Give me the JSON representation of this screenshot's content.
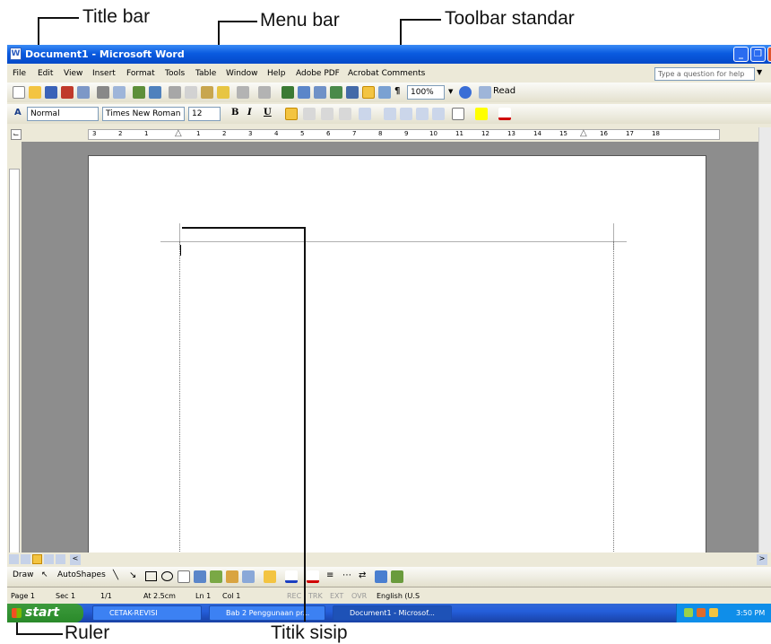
{
  "annotations": {
    "title_bar": "Title bar",
    "menu_bar": "Menu bar",
    "toolbar_standar": "Toolbar standar",
    "ruler": "Ruler",
    "titik_sisip": "Titik sisip"
  },
  "window": {
    "title": "Document1 - Microsoft Word"
  },
  "menu": [
    "File",
    "Edit",
    "View",
    "Insert",
    "Format",
    "Tools",
    "Table",
    "Window",
    "Help",
    "Adobe PDF",
    "Acrobat Comments"
  ],
  "help_box": {
    "placeholder": "Type a question for help"
  },
  "standard_toolbar": {
    "zoom": "100%",
    "read_label": "Read"
  },
  "formatting_toolbar": {
    "style": "Normal",
    "font": "Times New Roman",
    "size": "12",
    "bold": "B",
    "italic": "I",
    "underline": "U"
  },
  "ruler": {
    "labels": [
      "3",
      "2",
      "1",
      "1",
      "2",
      "3",
      "4",
      "5",
      "6",
      "7",
      "8",
      "9",
      "10",
      "11",
      "12",
      "13",
      "14",
      "15",
      "16",
      "17",
      "18"
    ]
  },
  "draw_toolbar": {
    "draw": "Draw",
    "autoshapes": "AutoShapes"
  },
  "status": {
    "page": "Page 1",
    "sec": "Sec 1",
    "pages": "1/1",
    "at": "At 2.5cm",
    "ln": "Ln 1",
    "col": "Col 1",
    "rec": "REC",
    "trk": "TRK",
    "ext": "EXT",
    "ovr": "OVR",
    "lang": "English (U.S"
  },
  "taskbar": {
    "start": "start",
    "items": [
      "CETAK-REVISI",
      "Bab 2 Penggunaan pr...",
      "Document1 - Microsof..."
    ],
    "clock": "3:50 PM"
  }
}
